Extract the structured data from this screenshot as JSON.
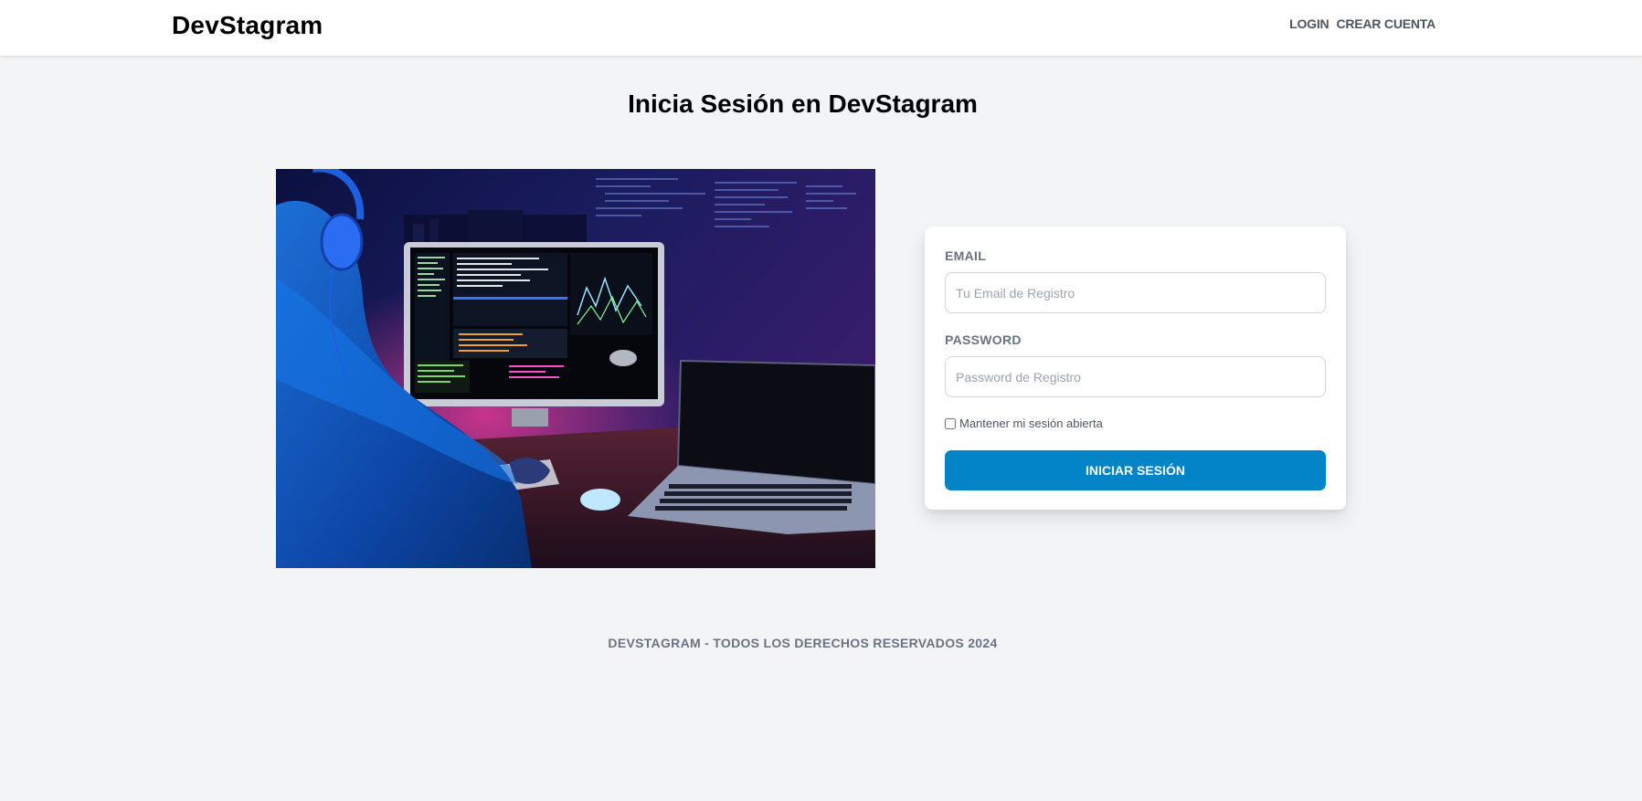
{
  "header": {
    "brand": "DevStagram",
    "nav": [
      {
        "label": "Login"
      },
      {
        "label": "Crear Cuenta"
      }
    ]
  },
  "main": {
    "title": "Inicia Sesión en DevStagram",
    "form": {
      "email_label": "Email",
      "email_placeholder": "Tu Email de Registro",
      "email_value": "",
      "password_label": "Password",
      "password_placeholder": "Password de Registro",
      "password_value": "",
      "remember_label": "Mantener mi sesión abierta",
      "remember_checked": false,
      "submit_label": "Iniciar Sesión"
    }
  },
  "footer": {
    "text": "DevStagram - Todos los derechos reservados 2024"
  },
  "colors": {
    "background": "#f3f4f6",
    "primary_button": "#0284c7",
    "label_gray": "#6b7280"
  }
}
